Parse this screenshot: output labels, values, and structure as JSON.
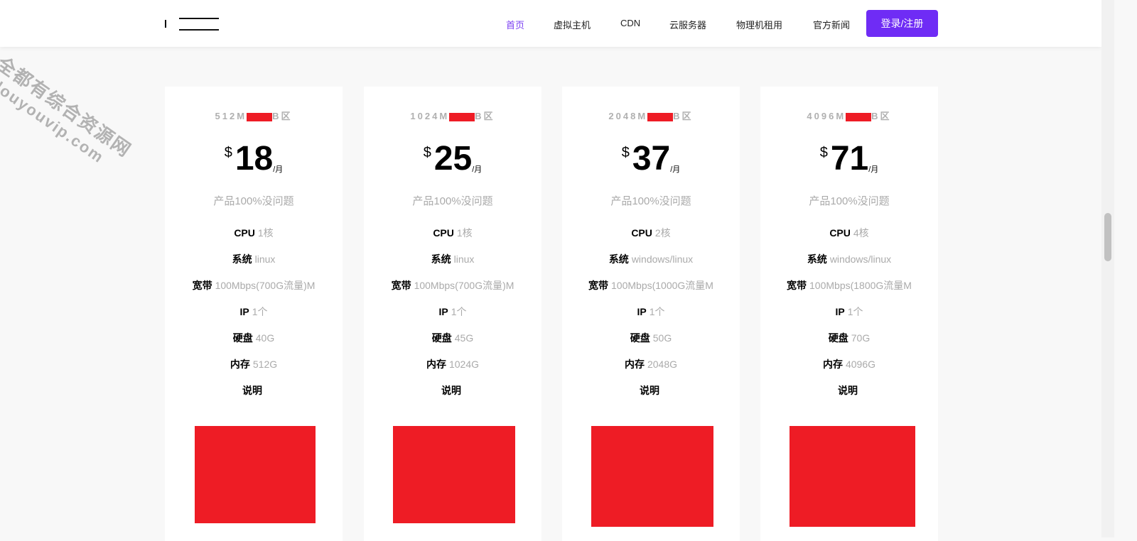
{
  "header": {
    "nav": [
      {
        "label": "首页",
        "active": true
      },
      {
        "label": "虚拟主机"
      },
      {
        "label": "CDN"
      },
      {
        "label": "云服务器"
      },
      {
        "label": "物理机租用"
      },
      {
        "label": "官方新闻"
      }
    ],
    "login_label": "登录/注册",
    "accent": "#6f2cf5"
  },
  "watermark": {
    "line1": "全都有综合资源网",
    "line2": "douyouvip.com"
  },
  "plans": [
    {
      "title_start": "512M",
      "title_end": "B区",
      "currency": "$",
      "price": "18",
      "unit": "/月",
      "subtitle": "产品100%没问题",
      "features": [
        [
          "CPU",
          "1核"
        ],
        [
          "系统",
          "linux"
        ],
        [
          "宽带",
          "100Mbps(700G流量)M"
        ],
        [
          "IP",
          "1个"
        ],
        [
          "硬盘",
          "40G"
        ],
        [
          "内存",
          "512G"
        ],
        [
          "说明",
          ""
        ]
      ]
    },
    {
      "title_start": "1024M",
      "title_end": "B区",
      "currency": "$",
      "price": "25",
      "unit": "/月",
      "subtitle": "产品100%没问题",
      "features": [
        [
          "CPU",
          "1核"
        ],
        [
          "系统",
          "linux"
        ],
        [
          "宽带",
          "100Mbps(700G流量)M"
        ],
        [
          "IP",
          "1个"
        ],
        [
          "硬盘",
          "45G"
        ],
        [
          "内存",
          "1024G"
        ],
        [
          "说明",
          ""
        ]
      ]
    },
    {
      "title_start": "2048M",
      "title_end": "B区",
      "currency": "$",
      "price": "37",
      "unit": "/月",
      "subtitle": "产品100%没问题",
      "features": [
        [
          "CPU",
          "2核"
        ],
        [
          "系统",
          "windows/linux"
        ],
        [
          "宽带",
          "100Mbps(1000G流量M"
        ],
        [
          "IP",
          "1个"
        ],
        [
          "硬盘",
          "50G"
        ],
        [
          "内存",
          "2048G"
        ],
        [
          "说明",
          ""
        ]
      ]
    },
    {
      "title_start": "4096M",
      "title_end": "B区",
      "currency": "$",
      "price": "71",
      "unit": "/月",
      "subtitle": "产品100%没问题",
      "features": [
        [
          "CPU",
          "4核"
        ],
        [
          "系统",
          "windows/linux"
        ],
        [
          "宽带",
          "100Mbps(1800G流量M"
        ],
        [
          "IP",
          "1个"
        ],
        [
          "硬盘",
          "70G"
        ],
        [
          "内存",
          "4096G"
        ],
        [
          "说明",
          ""
        ]
      ]
    }
  ]
}
